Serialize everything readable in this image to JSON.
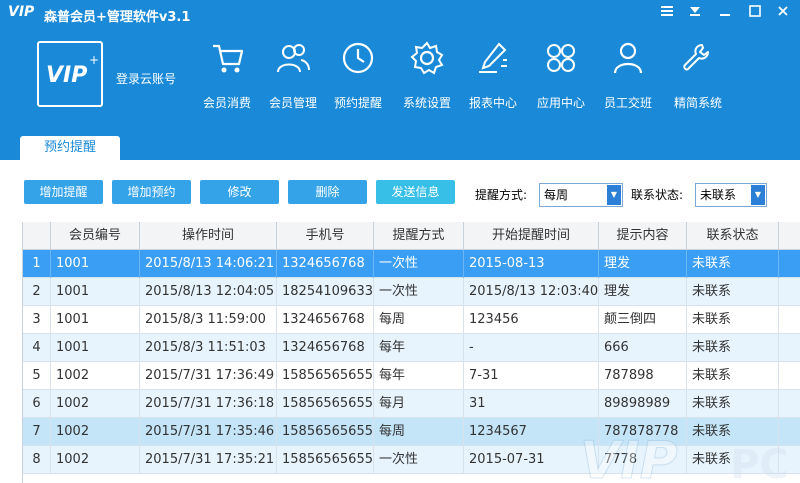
{
  "app": {
    "title": "森普会员+管理软件v3.1",
    "title_logo": "VIP",
    "logo_text": "VIP",
    "login_label": "登录云账号"
  },
  "window_controls": [
    "menu-icon",
    "skin-icon",
    "minimize-icon",
    "maximize-icon",
    "close-icon"
  ],
  "nav": [
    {
      "label": "会员消费",
      "icon": "cart-icon"
    },
    {
      "label": "会员管理",
      "icon": "users-icon"
    },
    {
      "label": "预约提醒",
      "icon": "clock-icon"
    },
    {
      "label": "系统设置",
      "icon": "gear-icon"
    },
    {
      "label": "报表中心",
      "icon": "pen-report-icon"
    },
    {
      "label": "应用中心",
      "icon": "apps-grid-icon"
    },
    {
      "label": "员工交班",
      "icon": "person-icon"
    },
    {
      "label": "精简系统",
      "icon": "wrench-icon"
    }
  ],
  "tab": {
    "label": "预约提醒"
  },
  "toolbar": {
    "buttons": [
      "增加提醒",
      "增加预约",
      "修改",
      "删除",
      "发送信息"
    ],
    "remind_mode_label": "提醒方式:",
    "remind_mode_value": "每周",
    "contact_status_label": "联系状态:",
    "contact_status_value": "未联系"
  },
  "table": {
    "columns": [
      "",
      "会员编号",
      "操作时间",
      "手机号",
      "提醒方式",
      "开始提醒时间",
      "提示内容",
      "联系状态"
    ],
    "rows": [
      [
        "1",
        "1001",
        "2015/8/13 14:06:21",
        "1324656768",
        "一次性",
        "2015-08-13",
        "理发",
        "未联系"
      ],
      [
        "2",
        "1001",
        "2015/8/13 12:04:05",
        "18254109633",
        "一次性",
        "2015/8/13 12:03:40",
        "理发",
        "未联系"
      ],
      [
        "3",
        "1001",
        "2015/8/3 11:59:00",
        "1324656768",
        "每周",
        "123456",
        "颠三倒四",
        "未联系"
      ],
      [
        "4",
        "1001",
        "2015/8/3 11:51:03",
        "1324656768",
        "每年",
        "-",
        "666",
        "未联系"
      ],
      [
        "5",
        "1002",
        "2015/7/31 17:36:49",
        "15856565655",
        "每年",
        "7-31",
        "787898",
        "未联系"
      ],
      [
        "6",
        "1002",
        "2015/7/31 17:36:18",
        "15856565655",
        "每月",
        "31",
        "89898989",
        "未联系"
      ],
      [
        "7",
        "1002",
        "2015/7/31 17:35:46",
        "15856565655",
        "每周",
        "1234567",
        "787878778",
        "未联系"
      ],
      [
        "8",
        "1002",
        "2015/7/31 17:35:21",
        "15856565655",
        "一次性",
        "2015-07-31",
        "7778",
        "未联系"
      ]
    ]
  },
  "watermark": {
    "text": "VIP"
  }
}
